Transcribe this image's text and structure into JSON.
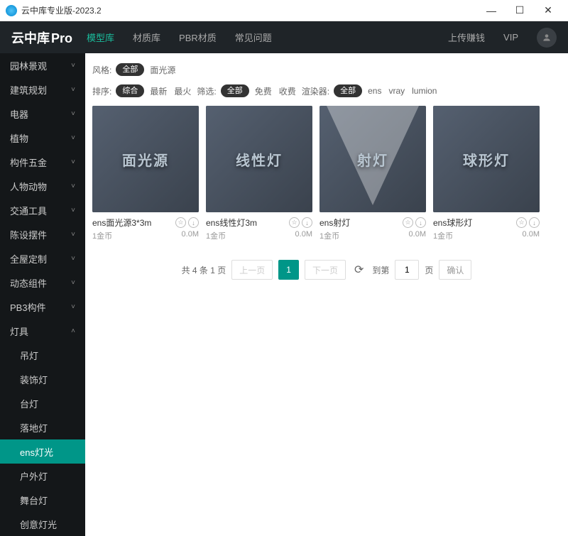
{
  "window": {
    "title": "云中库专业版-2023.2"
  },
  "brand": {
    "name": "云中库",
    "suffix": "Pro"
  },
  "nav": {
    "items": [
      "模型库",
      "材质库",
      "PBR材质",
      "常见问题"
    ],
    "active_index": 0,
    "right": [
      "上传赚钱",
      "VIP"
    ]
  },
  "sidebar": {
    "categories": [
      {
        "label": "园林景观",
        "expanded": false
      },
      {
        "label": "建筑规划",
        "expanded": false
      },
      {
        "label": "电器",
        "expanded": false
      },
      {
        "label": "植物",
        "expanded": false
      },
      {
        "label": "构件五金",
        "expanded": false
      },
      {
        "label": "人物动物",
        "expanded": false
      },
      {
        "label": "交通工具",
        "expanded": false
      },
      {
        "label": "陈设摆件",
        "expanded": false
      },
      {
        "label": "全屋定制",
        "expanded": false
      },
      {
        "label": "动态组件",
        "expanded": false
      },
      {
        "label": "PB3构件",
        "expanded": false
      },
      {
        "label": "灯具",
        "expanded": true
      }
    ],
    "subs": [
      "吊灯",
      "装饰灯",
      "台灯",
      "落地灯",
      "ens灯光",
      "户外灯",
      "舞台灯",
      "创意灯光"
    ],
    "active_sub": "ens灯光"
  },
  "filters": {
    "style_label": "风格:",
    "style_all": "全部",
    "style_opts": [
      "面光源"
    ],
    "sort_label": "排序:",
    "sort_all": "综合",
    "sort_opts": [
      "最新",
      "最火"
    ],
    "select_label": "筛选:",
    "select_all": "全部",
    "select_opts": [
      "免费",
      "收费"
    ],
    "render_label": "渲染器:",
    "render_all": "全部",
    "render_opts": [
      "ens",
      "vray",
      "lumion"
    ]
  },
  "cards": [
    {
      "thumb_text": "面光源",
      "title": "ens面光源3*3m",
      "price": "1金币",
      "size": "0.0M"
    },
    {
      "thumb_text": "线性灯",
      "title": "ens线性灯3m",
      "price": "1金币",
      "size": "0.0M"
    },
    {
      "thumb_text": "射灯",
      "title": "ens射灯",
      "price": "1金币",
      "size": "0.0M",
      "spotlight": true
    },
    {
      "thumb_text": "球形灯",
      "title": "ens球形灯",
      "price": "1金币",
      "size": "0.0M"
    }
  ],
  "pagination": {
    "summary": "共 4 条 1 页",
    "prev": "上一页",
    "next": "下一页",
    "current": "1",
    "jump_label": "到第",
    "jump_input": "1",
    "page_unit": "页",
    "confirm": "确认"
  }
}
